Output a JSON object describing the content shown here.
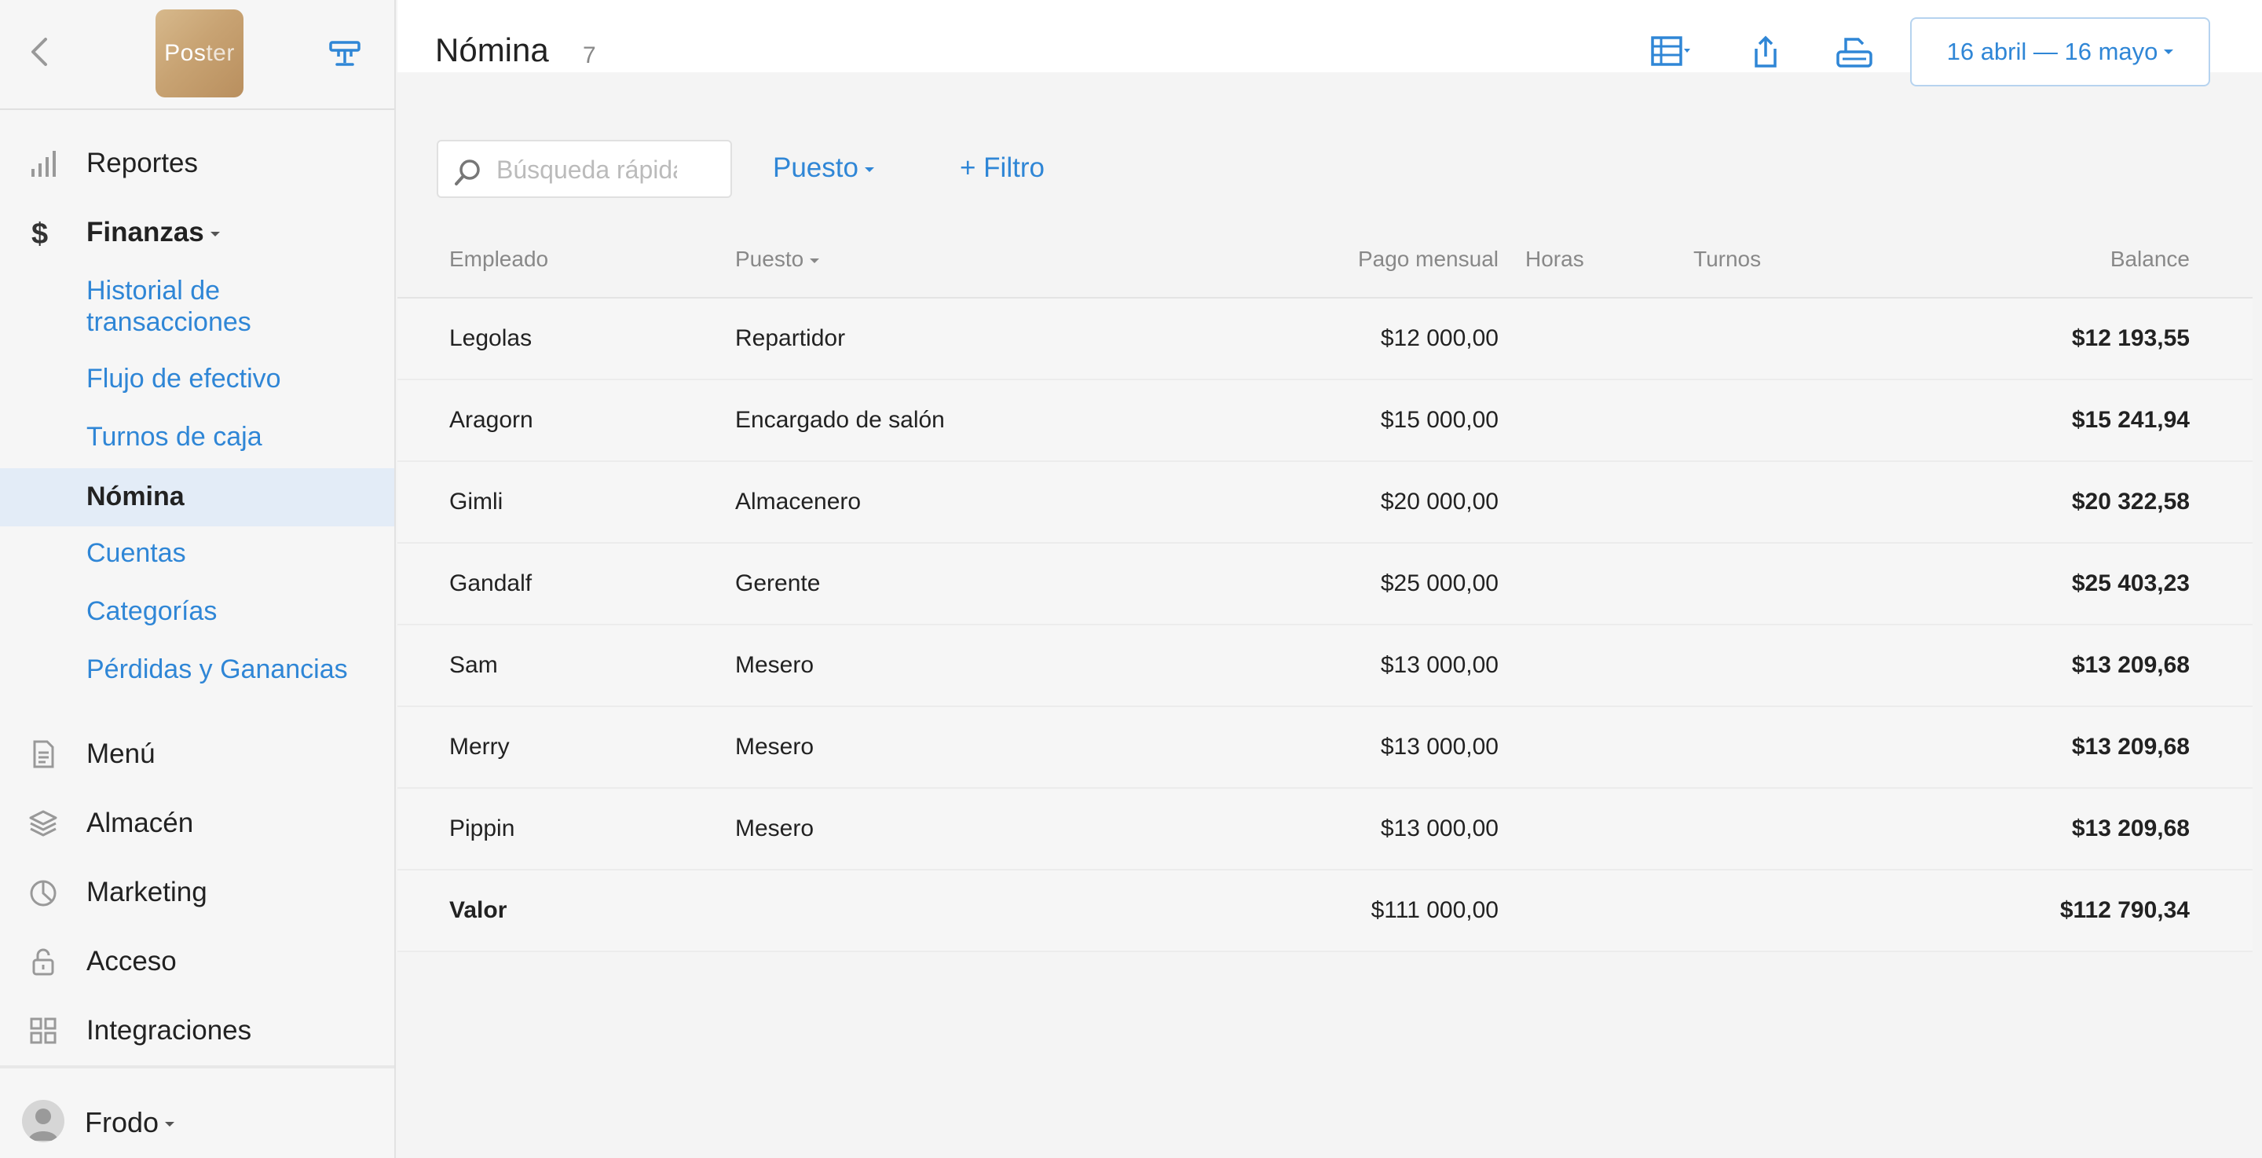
{
  "sidebar": {
    "logo_text_a": "Pos",
    "logo_text_b": "ter",
    "nav": [
      {
        "label": "Reportes",
        "icon": "bar-chart-icon"
      },
      {
        "label": "Finanzas",
        "icon": "dollar-icon"
      },
      {
        "label": "Menú",
        "icon": "document-icon"
      },
      {
        "label": "Almacén",
        "icon": "layers-icon"
      },
      {
        "label": "Marketing",
        "icon": "pie-icon"
      },
      {
        "label": "Acceso",
        "icon": "lock-icon"
      },
      {
        "label": "Integraciones",
        "icon": "grid-icon"
      }
    ],
    "finanzas_sub": [
      {
        "label": "Historial de transacciones"
      },
      {
        "label": "Flujo de efectivo"
      },
      {
        "label": "Turnos de caja"
      },
      {
        "label": "Nómina"
      },
      {
        "label": "Cuentas"
      },
      {
        "label": "Categorías"
      },
      {
        "label": "Pérdidas y Ganancias"
      }
    ],
    "sub_first_line1": "Historial de",
    "sub_first_line2": "transacciones",
    "user": "Frodo"
  },
  "header": {
    "title": "Nómina",
    "count": "7",
    "date_range": "16 abril — 16 mayo"
  },
  "filters": {
    "search_placeholder": "Búsqueda rápida",
    "puesto": "Puesto",
    "add_filter": "+ Filtro"
  },
  "table": {
    "columns": {
      "empleado": "Empleado",
      "puesto": "Puesto",
      "pago": "Pago mensual",
      "horas": "Horas",
      "turnos": "Turnos",
      "balance": "Balance"
    },
    "rows": [
      {
        "empleado": "Legolas",
        "puesto": "Repartidor",
        "pago": "$12 000,00",
        "horas": "",
        "turnos": "",
        "balance": "$12 193,55"
      },
      {
        "empleado": "Aragorn",
        "puesto": "Encargado de salón",
        "pago": "$15 000,00",
        "horas": "",
        "turnos": "",
        "balance": "$15 241,94"
      },
      {
        "empleado": "Gimli",
        "puesto": "Almacenero",
        "pago": "$20 000,00",
        "horas": "",
        "turnos": "",
        "balance": "$20 322,58"
      },
      {
        "empleado": "Gandalf",
        "puesto": "Gerente",
        "pago": "$25 000,00",
        "horas": "",
        "turnos": "",
        "balance": "$25 403,23"
      },
      {
        "empleado": "Sam",
        "puesto": "Mesero",
        "pago": "$13 000,00",
        "horas": "",
        "turnos": "",
        "balance": "$13 209,68"
      },
      {
        "empleado": "Merry",
        "puesto": "Mesero",
        "pago": "$13 000,00",
        "horas": "",
        "turnos": "",
        "balance": "$13 209,68"
      },
      {
        "empleado": "Pippin",
        "puesto": "Mesero",
        "pago": "$13 000,00",
        "horas": "",
        "turnos": "",
        "balance": "$13 209,68"
      }
    ],
    "total": {
      "label": "Valor",
      "pago": "$111 000,00",
      "balance": "$112 790,34"
    }
  },
  "colors": {
    "accent": "#2f86d6",
    "active_bg": "#e3ecf7"
  }
}
